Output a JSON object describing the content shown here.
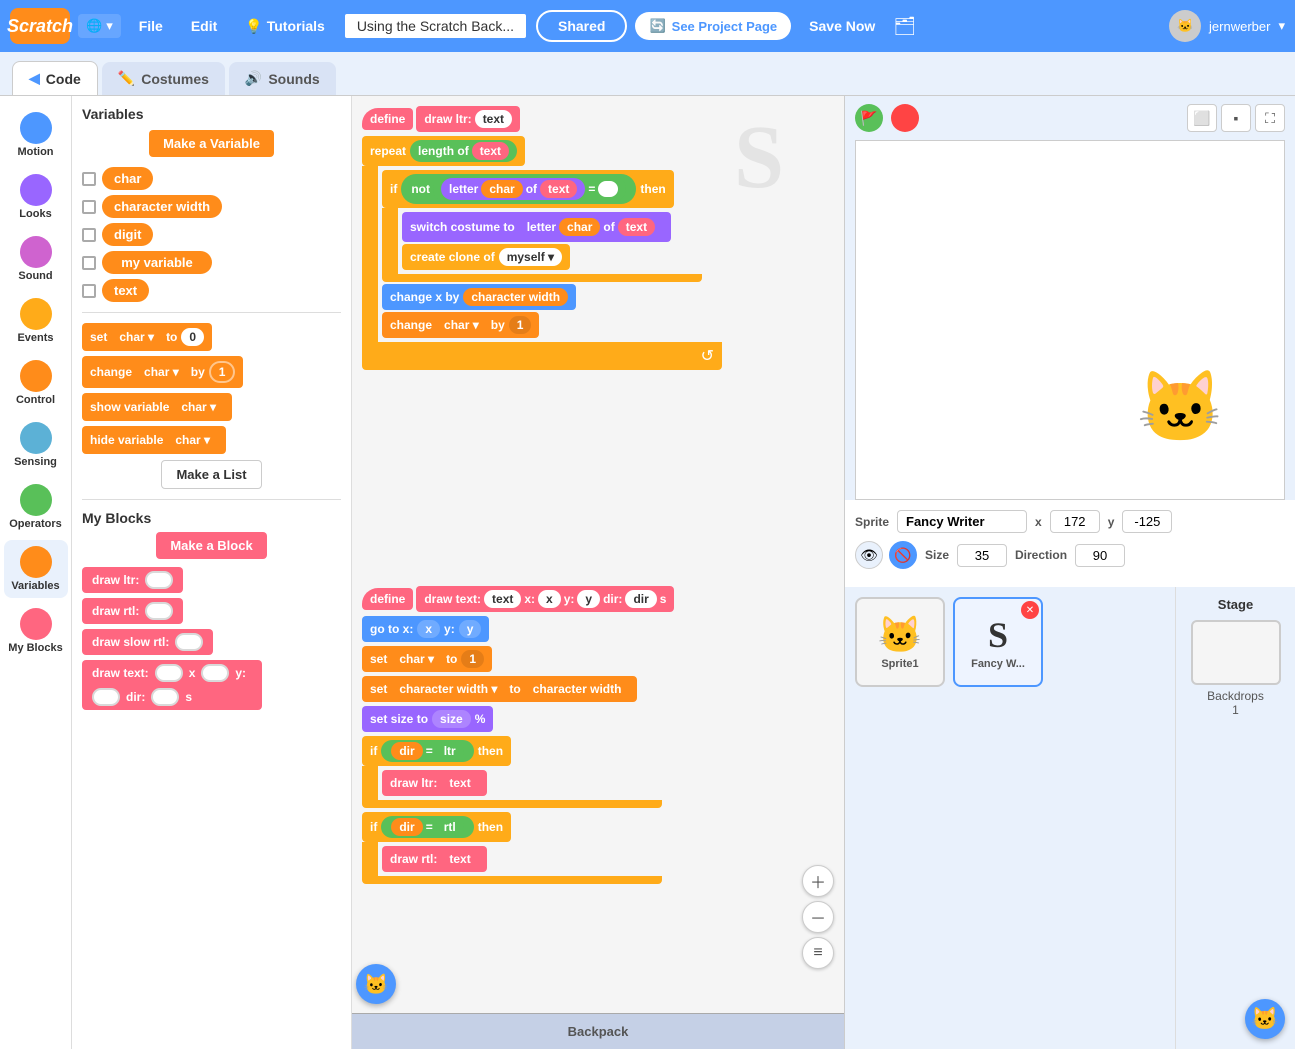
{
  "topnav": {
    "logo": "Scratch",
    "language_icon": "🌐",
    "file_label": "File",
    "edit_label": "Edit",
    "tutorials_icon": "💡",
    "tutorials_label": "Tutorials",
    "project_title": "Using the Scratch Back...",
    "shared_label": "Shared",
    "see_project_label": "See Project Page",
    "save_label": "Save Now",
    "folder_icon": "🗂",
    "username": "jernwerber",
    "avatar_icon": "🐱"
  },
  "tabs": [
    {
      "label": "Code",
      "icon": "◀",
      "active": true
    },
    {
      "label": "Costumes",
      "icon": "✏️",
      "active": false
    },
    {
      "label": "Sounds",
      "icon": "🔊",
      "active": false
    }
  ],
  "sidebar": {
    "items": [
      {
        "label": "Motion",
        "color": "#4d97ff"
      },
      {
        "label": "Looks",
        "color": "#9966ff"
      },
      {
        "label": "Sound",
        "color": "#cf63cf"
      },
      {
        "label": "Events",
        "color": "#ffab19"
      },
      {
        "label": "Control",
        "color": "#ff8c1a"
      },
      {
        "label": "Sensing",
        "color": "#5cb1d6"
      },
      {
        "label": "Operators",
        "color": "#59c059"
      },
      {
        "label": "Variables",
        "color": "#ff8c1a",
        "active": true
      },
      {
        "label": "My Blocks",
        "color": "#ff6680"
      }
    ]
  },
  "blocks_panel": {
    "variables_title": "Variables",
    "make_variable_btn": "Make a Variable",
    "variables": [
      {
        "name": "char",
        "checked": false
      },
      {
        "name": "character width",
        "checked": false
      },
      {
        "name": "digit",
        "checked": false
      },
      {
        "name": "my variable",
        "checked": false
      },
      {
        "name": "text",
        "checked": false
      }
    ],
    "set_label": "set",
    "change_label": "change",
    "to_label": "to",
    "by_label": "by",
    "show_variable_label": "show variable",
    "hide_variable_label": "hide variable",
    "char_var": "char",
    "value_0": "0",
    "value_1": "1",
    "myblocks_title": "My Blocks",
    "make_block_btn": "Make a Block",
    "custom_blocks": [
      {
        "name": "draw ltr:",
        "has_input": true
      },
      {
        "name": "draw rtl:",
        "has_input": true
      },
      {
        "name": "draw slow rtl:",
        "has_input": true
      },
      {
        "name": "draw text:",
        "has_inputs": true,
        "extra": "x  y:  dir: s"
      }
    ]
  },
  "code_area": {
    "backpack_label": "Backpack"
  },
  "stage": {
    "sprite_label": "Sprite",
    "sprite_name": "Fancy Writer",
    "x_label": "x",
    "x_value": "172",
    "y_label": "y",
    "y_value": "-125",
    "size_label": "Size",
    "size_value": "35",
    "direction_label": "Direction",
    "direction_value": "90",
    "stage_label": "Stage",
    "backdrops_label": "Backdrops",
    "backdrops_count": "1",
    "sprites": [
      {
        "name": "Sprite1",
        "icon": "🐱",
        "selected": false
      },
      {
        "name": "Fancy W...",
        "icon": "S",
        "selected": true,
        "letter_style": true
      }
    ]
  }
}
